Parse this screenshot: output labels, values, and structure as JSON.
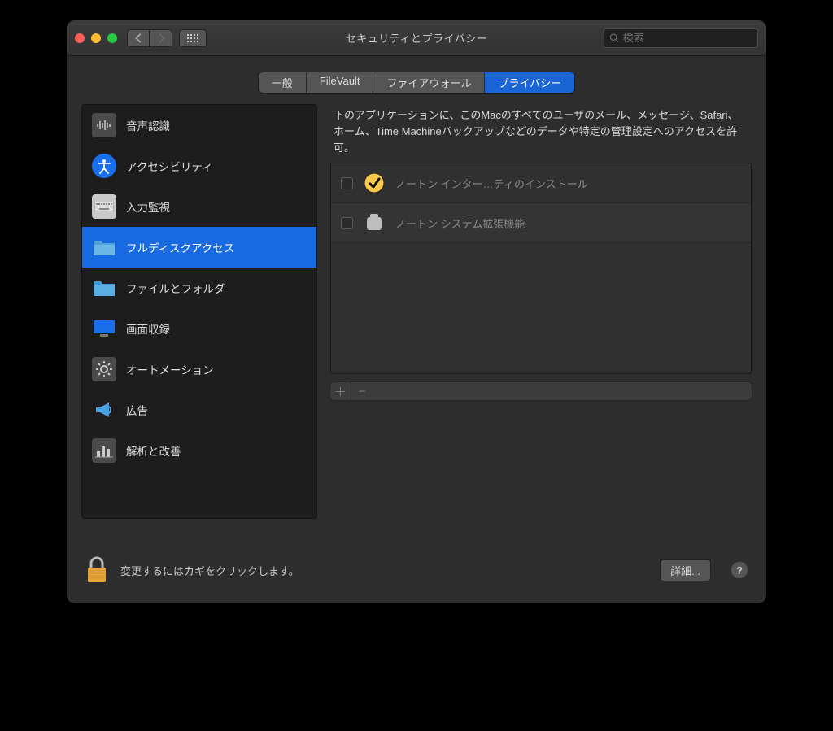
{
  "window": {
    "title": "セキュリティとプライバシー",
    "search_placeholder": "検索"
  },
  "tabs": [
    {
      "label": "一般",
      "active": false
    },
    {
      "label": "FileVault",
      "active": false
    },
    {
      "label": "ファイアウォール",
      "active": false
    },
    {
      "label": "プライバシー",
      "active": true
    }
  ],
  "sidebar": {
    "items": [
      {
        "id": "speech-recognition",
        "label": "音声認識",
        "selected": false
      },
      {
        "id": "accessibility",
        "label": "アクセシビリティ",
        "selected": false
      },
      {
        "id": "input-monitoring",
        "label": "入力監視",
        "selected": false
      },
      {
        "id": "full-disk-access",
        "label": "フルディスクアクセス",
        "selected": true
      },
      {
        "id": "files-and-folders",
        "label": "ファイルとフォルダ",
        "selected": false
      },
      {
        "id": "screen-recording",
        "label": "画面収録",
        "selected": false
      },
      {
        "id": "automation",
        "label": "オートメーション",
        "selected": false
      },
      {
        "id": "advertising",
        "label": "広告",
        "selected": false
      },
      {
        "id": "analytics",
        "label": "解析と改善",
        "selected": false
      }
    ]
  },
  "content": {
    "description": "下のアプリケーションに、このMacのすべてのユーザのメール、メッセージ、Safari、ホーム、Time Machineバックアップなどのデータや特定の管理設定へのアクセスを許可。",
    "apps": [
      {
        "name": "ノートン インター…ティのインストール",
        "checked": false,
        "icon": "norton"
      },
      {
        "name": "ノートン システム拡張機能",
        "checked": false,
        "icon": "extension"
      }
    ]
  },
  "footer": {
    "lock_text": "変更するにはカギをクリックします。",
    "details_button": "詳細...",
    "help": "?"
  }
}
